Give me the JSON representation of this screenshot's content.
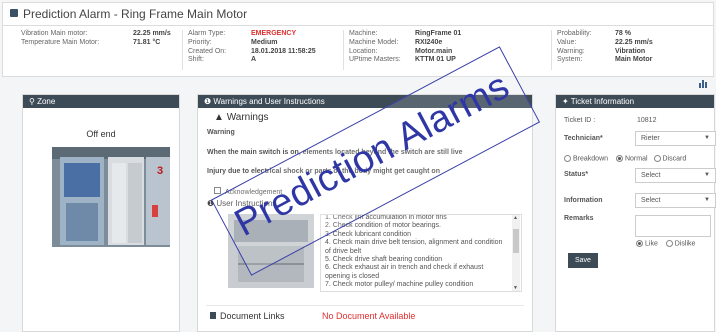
{
  "header": {
    "title": "Prediction Alarm - Ring Frame Main Motor"
  },
  "info": {
    "c1": [
      {
        "label": "Vibration Main motor:",
        "value": "22.25 mm/s"
      },
      {
        "label": "Temperature Main Motor:",
        "value": "71.81 °C"
      }
    ],
    "c2": [
      {
        "label": "Alarm Type:",
        "value": "EMERGENCY"
      },
      {
        "label": "Priority:",
        "value": "Medium"
      },
      {
        "label": "Created On:",
        "value": "18.01.2018 11:58:25"
      },
      {
        "label": "Shift:",
        "value": "A"
      }
    ],
    "c3": [
      {
        "label": "Machine:",
        "value": "RingFrame 01"
      },
      {
        "label": "Machine Model:",
        "value": "RXI240e"
      },
      {
        "label": "Location:",
        "value": "Motor.main"
      },
      {
        "label": "UPtime Masters:",
        "value": "KTTM 01 UP"
      }
    ],
    "c4": [
      {
        "label": "Probability:",
        "value": "78 %"
      },
      {
        "label": "Value:",
        "value": "22.25 mm/s"
      },
      {
        "label": "Warning:",
        "value": "Vibration"
      },
      {
        "label": "System:",
        "value": "Main Motor"
      }
    ],
    "emergency_color": "#e03030"
  },
  "zone": {
    "header": "Zone",
    "title": "Off end",
    "image_icon": "machine-photo",
    "machine_number": "3"
  },
  "warnings": {
    "header": "Warnings and User Instructions",
    "subheader": "Warnings",
    "label": "Warning",
    "line1": "When the main switch is on, elements located beyond the switch are still live",
    "line2": "Injury due to electrical shock or parts of the body might get caught on",
    "ack": "Acknowledgement",
    "ui_label": "User Instructions",
    "instructions": [
      "1. Check lint accumulation in motor fins",
      "2. Check condition of motor bearings.",
      "3. Check lubricant condition",
      "4. Check main drive belt tension, alignment and condition of drive belt",
      "5. Check drive shaft bearing condition",
      "6. Check exhaust air in trench and check if exhaust opening is closed",
      "7. Check motor pulley/ machine pulley condition"
    ],
    "doc_label": "Document Links",
    "doc_status": "No Document Available"
  },
  "ticket": {
    "header": "Ticket Information",
    "id_label": "Ticket ID :",
    "id_value": "10812",
    "tech_label": "Technician*",
    "tech_value": "Rieter",
    "r1": "Breakdown",
    "r2": "Normal",
    "r3": "Discard",
    "status_label": "Status*",
    "status_value": "Select",
    "info_label": "Information",
    "info_value": "Select",
    "remarks_label": "Remarks",
    "like": "Like",
    "dislike": "Dislike",
    "save": "Save"
  },
  "overlay": {
    "text": "Prediction Alarms"
  }
}
